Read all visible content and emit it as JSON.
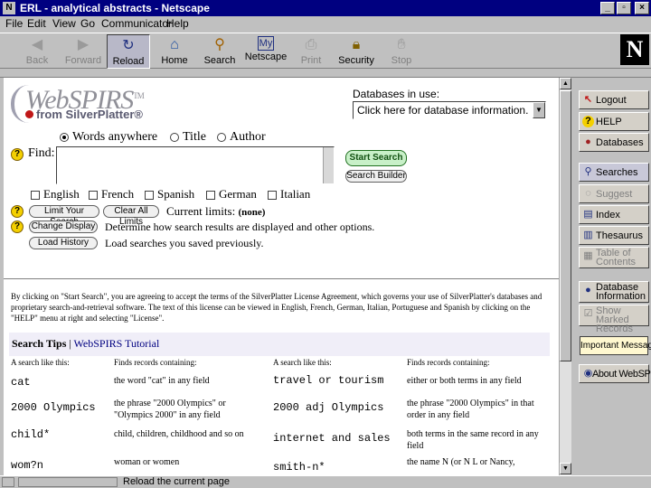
{
  "window": {
    "title": "ERL - analytical abstracts - Netscape"
  },
  "menu": [
    "File",
    "Edit",
    "View",
    "Go",
    "Communicator",
    "Help"
  ],
  "toolbar": [
    {
      "label": "Back",
      "icon": "back-arrow-icon",
      "disabled": true
    },
    {
      "label": "Forward",
      "icon": "forward-arrow-icon",
      "disabled": true
    },
    {
      "label": "Reload",
      "icon": "reload-icon",
      "disabled": false
    },
    {
      "label": "Home",
      "icon": "home-icon",
      "disabled": false
    },
    {
      "label": "Search",
      "icon": "search-icon",
      "disabled": false
    },
    {
      "label": "Netscape",
      "icon": "netscape-my-icon",
      "disabled": false
    },
    {
      "label": "Print",
      "icon": "print-icon",
      "disabled": true
    },
    {
      "label": "Security",
      "icon": "lock-icon",
      "disabled": false
    },
    {
      "label": "Stop",
      "icon": "stop-icon",
      "disabled": true
    }
  ],
  "brand": {
    "logo_main": "WebSPIRS",
    "tm": "TM",
    "logo_sub": "from SilverPlatter",
    "reg": "®"
  },
  "databases": {
    "label": "Databases in use:",
    "select_value": "Click here for database information."
  },
  "search": {
    "modes": [
      {
        "label": "Words anywhere",
        "selected": true
      },
      {
        "label": "Title",
        "selected": false
      },
      {
        "label": "Author",
        "selected": false
      }
    ],
    "find_label": "Find:",
    "start_label": "Start Search",
    "builder_label": "Search Builder",
    "languages": [
      "English",
      "French",
      "Spanish",
      "German",
      "Italian"
    ],
    "limit_label": "Limit Your Search",
    "clear_label": "Clear All Limits",
    "current_limits_label": "Current limits:",
    "current_limits_value": "(none)",
    "display_label": "Change Display",
    "display_desc": "Determine how search results are displayed and other options.",
    "history_label": "Load History",
    "history_desc": "Load searches you saved previously."
  },
  "license": {
    "text": "By clicking on \"Start Search\", you are agreeing to accept the terms of the SilverPlatter License Agreement, which governs your use of SilverPlatter's databases and proprietary search-and-retrieval software. The text of this license can be viewed in English, French, German, Italian, Portuguese and Spanish by clicking on the \"HELP\" menu at right and selecting \"License\"."
  },
  "tips": {
    "title": "Search Tips",
    "sep": " | ",
    "tutorial": "WebSPIRS Tutorial",
    "headers": [
      "A search like this:",
      "Finds records containing:",
      "A search like this:",
      "Finds records containing:"
    ],
    "rows": [
      [
        "cat",
        "the word \"cat\" in any field",
        "travel or tourism",
        "either or both terms in any field"
      ],
      [
        "2000 Olympics",
        "the phrase \"2000 Olympics\" or \"Olympics 2000\" in any field",
        "2000 adj Olympics",
        "the phrase \"2000 Olympics\" in that order in any field"
      ],
      [
        "child*",
        "child, children, childhood and so on",
        "internet and sales",
        "both terms in the same record in any field"
      ],
      [
        "wom?n",
        "woman or women",
        "smith-n*",
        "the name N (or N L or Nancy,"
      ]
    ]
  },
  "sidebar": [
    {
      "label": "Logout",
      "icon": "logout-icon",
      "dim": false
    },
    {
      "label": "HELP",
      "icon": "help-icon",
      "dim": false
    },
    {
      "label": "Databases",
      "icon": "databases-icon",
      "dim": false
    },
    {
      "label": "Searches",
      "icon": "searches-icon",
      "dim": false,
      "selected": true
    },
    {
      "label": "Suggest",
      "icon": "suggest-icon",
      "dim": true
    },
    {
      "label": "Index",
      "icon": "index-icon",
      "dim": false
    },
    {
      "label": "Thesaurus",
      "icon": "thesaurus-icon",
      "dim": false
    },
    {
      "label": "Table of Contents",
      "icon": "toc-icon",
      "dim": true
    },
    {
      "label": "Database Information",
      "icon": "database-info-icon",
      "dim": false
    },
    {
      "label": "Show Marked Records",
      "icon": "marked-records-icon",
      "dim": true
    },
    {
      "label": "Important Message",
      "icon": "",
      "dim": false
    },
    {
      "label": "About WebSPIRS",
      "icon": "about-icon",
      "dim": false
    }
  ],
  "status": {
    "text": "Reload the current page"
  },
  "colors": {
    "titlebar": "#000080",
    "tips_bg": "#f0eef8",
    "start_button": "#c8f0c8",
    "help_yellow": "#f4d000"
  }
}
